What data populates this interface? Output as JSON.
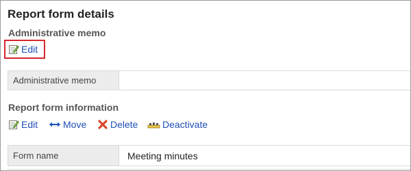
{
  "page": {
    "title": "Report form details"
  },
  "admin_memo": {
    "section_title": "Administrative memo",
    "edit_label": "Edit",
    "table_label": "Administrative memo",
    "table_value": ""
  },
  "form_info": {
    "section_title": "Report form information",
    "actions": {
      "edit": "Edit",
      "move": "Move",
      "delete": "Delete",
      "deactivate": "Deactivate"
    },
    "rows": [
      {
        "label": "Form name",
        "value": "Meeting minutes"
      }
    ]
  },
  "colors": {
    "link": "#1f4fb6",
    "highlight": "#d6262d",
    "delete_icon": "#d8462b"
  }
}
